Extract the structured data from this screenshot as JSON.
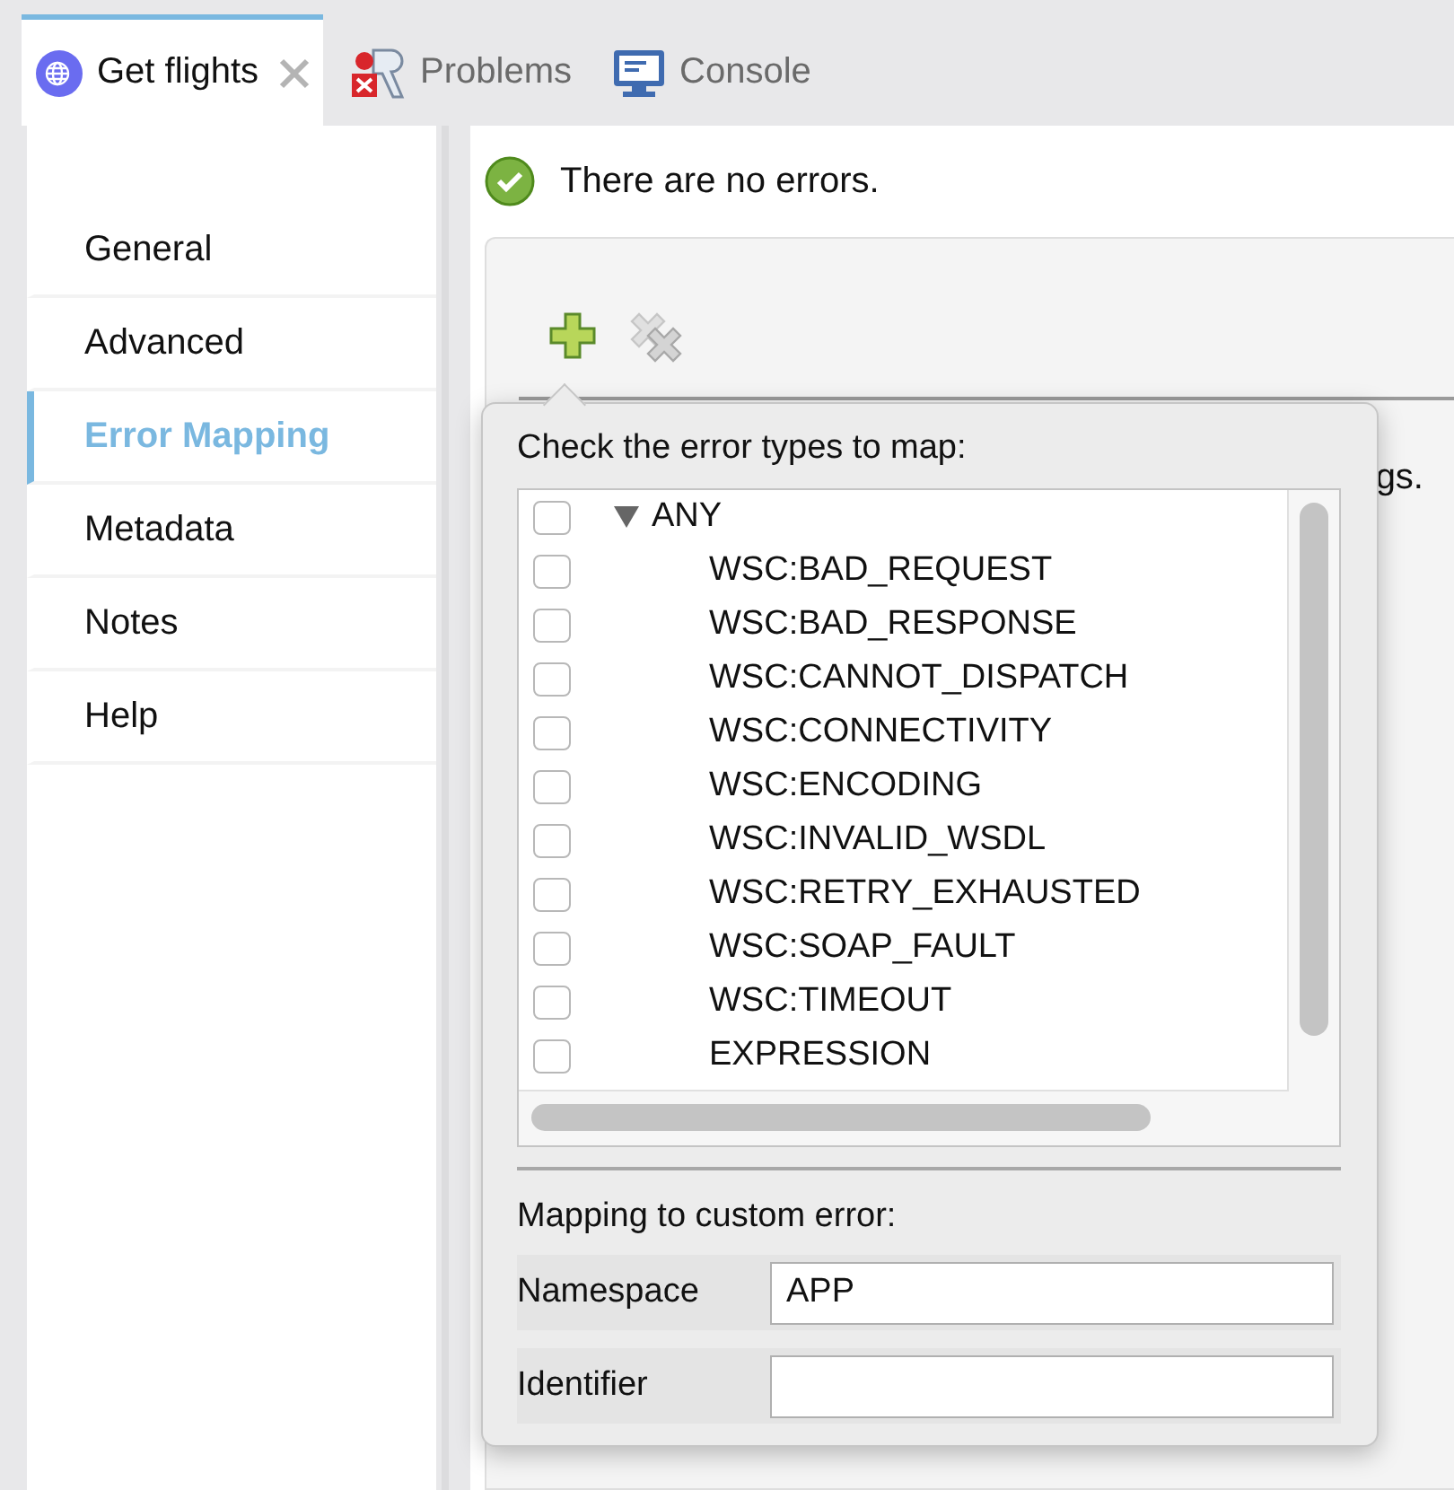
{
  "tabs": [
    {
      "label": "Get flights",
      "selected": true,
      "closable": true,
      "kind": "flow"
    },
    {
      "label": "Problems",
      "selected": false,
      "kind": "problems"
    },
    {
      "label": "Console",
      "selected": false,
      "kind": "console"
    }
  ],
  "sidebar": {
    "items": [
      {
        "label": "General",
        "selected": false
      },
      {
        "label": "Advanced",
        "selected": false
      },
      {
        "label": "Error Mapping",
        "selected": true
      },
      {
        "label": "Metadata",
        "selected": false
      },
      {
        "label": "Notes",
        "selected": false
      },
      {
        "label": "Help",
        "selected": false
      }
    ]
  },
  "status": {
    "kind": "ok",
    "message": "There are no errors."
  },
  "toolbar": {
    "buttons": [
      {
        "kind": "add",
        "disabled": false
      },
      {
        "kind": "remove",
        "disabled": true
      }
    ]
  },
  "panel_text": "gs.",
  "popup": {
    "title": "Check the error types to map:",
    "tree": [
      {
        "label": "ANY",
        "checked": false,
        "expanded": true,
        "children": [
          {
            "label": "WSC:BAD_REQUEST",
            "checked": false
          },
          {
            "label": "WSC:BAD_RESPONSE",
            "checked": false
          },
          {
            "label": "WSC:CANNOT_DISPATCH",
            "checked": false
          },
          {
            "label": "WSC:CONNECTIVITY",
            "checked": false
          },
          {
            "label": "WSC:ENCODING",
            "checked": false
          },
          {
            "label": "WSC:INVALID_WSDL",
            "checked": false
          },
          {
            "label": "WSC:RETRY_EXHAUSTED",
            "checked": false
          },
          {
            "label": "WSC:SOAP_FAULT",
            "checked": false
          },
          {
            "label": "WSC:TIMEOUT",
            "checked": false
          },
          {
            "label": "EXPRESSION",
            "checked": false
          }
        ]
      }
    ],
    "mapping": {
      "title": "Mapping to custom error:",
      "fields": [
        {
          "label": "Namespace",
          "value": "APP"
        },
        {
          "label": "Identifier"
        }
      ]
    }
  }
}
